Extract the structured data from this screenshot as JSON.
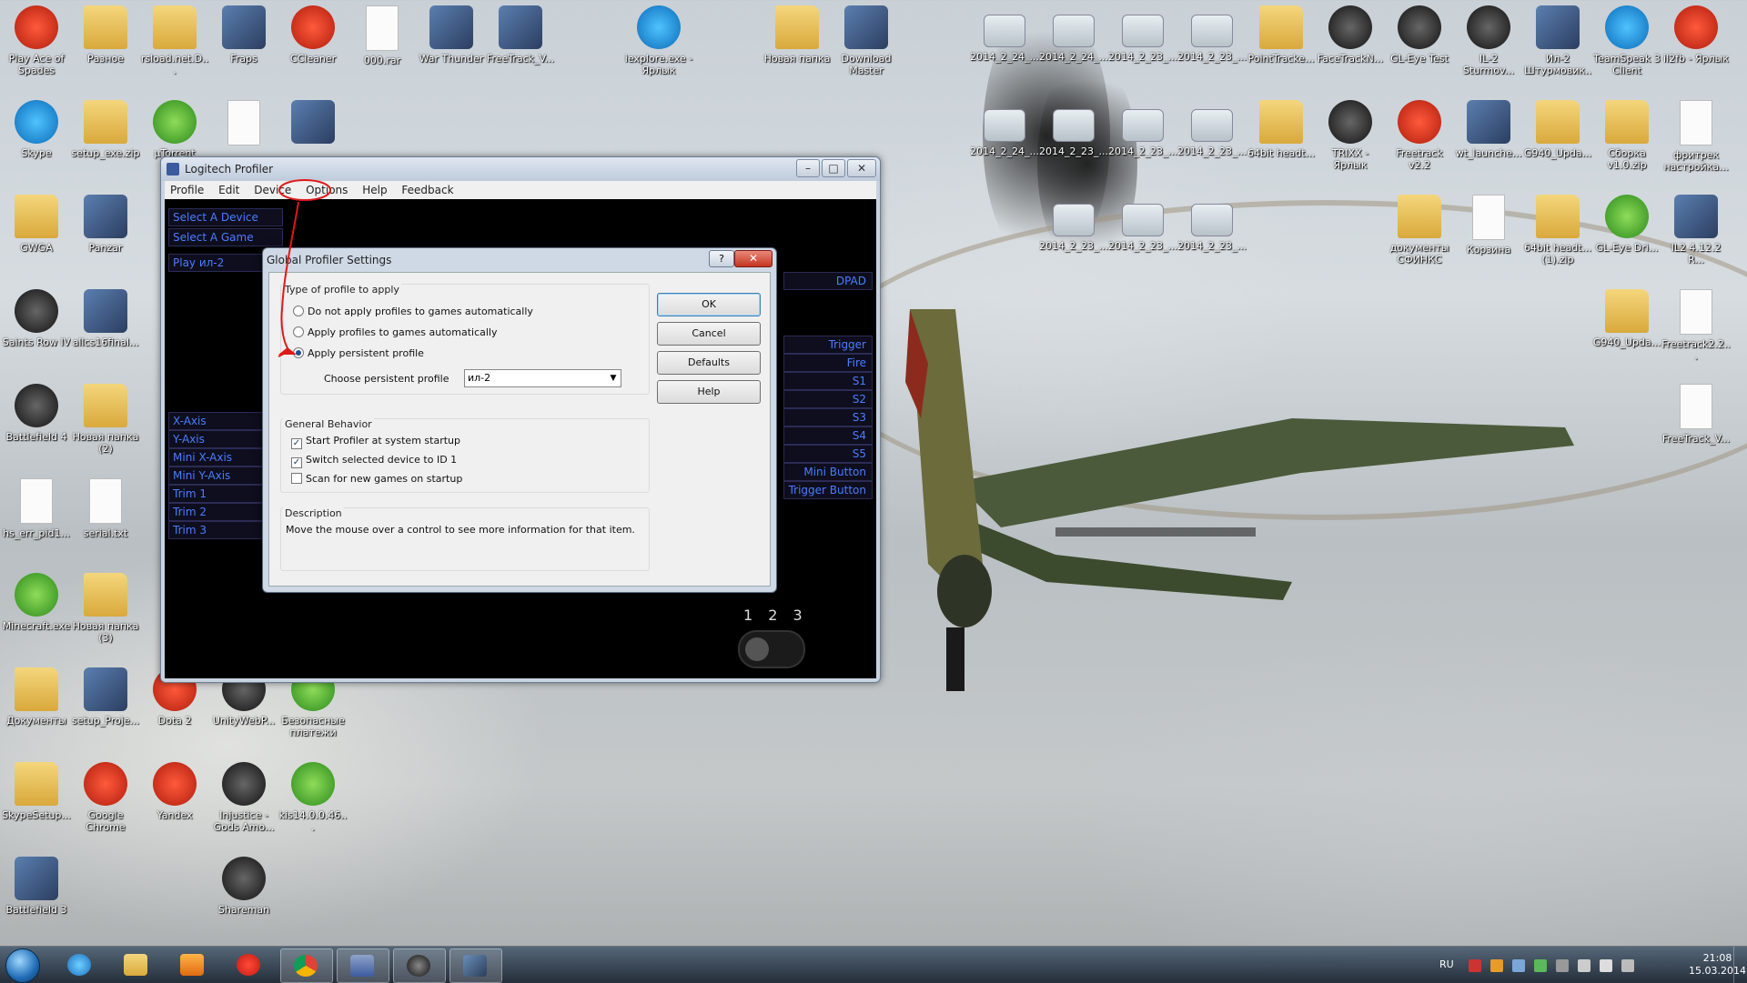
{
  "desktop_icons": [
    {
      "label": "Play Ace of Spades",
      "kind": "red"
    },
    {
      "label": "Разное",
      "kind": "folder"
    },
    {
      "label": "rsload.net.D...",
      "kind": "folder"
    },
    {
      "label": "Fraps",
      "kind": "app"
    },
    {
      "label": "CCleaner",
      "kind": "red"
    },
    {
      "label": "000.rar",
      "kind": "file"
    },
    {
      "label": "War Thunder",
      "kind": "app"
    },
    {
      "label": "FreeTrack_V...",
      "kind": "app"
    },
    {
      "label": "iexplore.exe - Ярлык",
      "kind": "blue"
    },
    {
      "label": "Новая папка",
      "kind": "folder"
    },
    {
      "label": "Download Master",
      "kind": "app"
    },
    {
      "label": "2014_2_24_...",
      "kind": "thumb"
    },
    {
      "label": "2014_2_24_...",
      "kind": "thumb"
    },
    {
      "label": "2014_2_23_...",
      "kind": "thumb"
    },
    {
      "label": "2014_2_23_...",
      "kind": "thumb"
    },
    {
      "label": "PointTracke...",
      "kind": "folder"
    },
    {
      "label": "FaceTrackN...",
      "kind": "dark"
    },
    {
      "label": "GL-Eye Test",
      "kind": "dark"
    },
    {
      "label": "IL-2 Sturmov...",
      "kind": "dark"
    },
    {
      "label": "Ил-2 Штурмовик...",
      "kind": "app"
    },
    {
      "label": "TeamSpeak 3 Client",
      "kind": "blue"
    },
    {
      "label": "il2fb - Ярлык",
      "kind": "red"
    },
    {
      "label": "Skype",
      "kind": "blue"
    },
    {
      "label": "setup_exe.zip",
      "kind": "folder"
    },
    {
      "label": "µTorrent",
      "kind": "green"
    },
    {
      "label": "",
      "kind": "file"
    },
    {
      "label": "",
      "kind": "app"
    },
    {
      "label": "2014_2_24_...",
      "kind": "thumb"
    },
    {
      "label": "2014_2_23_...",
      "kind": "thumb"
    },
    {
      "label": "2014_2_23_...",
      "kind": "thumb"
    },
    {
      "label": "2014_2_23_...",
      "kind": "thumb"
    },
    {
      "label": "64bit headt...",
      "kind": "folder"
    },
    {
      "label": "TRIXX - Ярлык",
      "kind": "dark"
    },
    {
      "label": "Freetrack v2.2",
      "kind": "red"
    },
    {
      "label": "wt_launche...",
      "kind": "app"
    },
    {
      "label": "G940_Upda...",
      "kind": "folder"
    },
    {
      "label": "Сборка v1.0.zip",
      "kind": "folder"
    },
    {
      "label": "фритрек настройка...",
      "kind": "file"
    },
    {
      "label": "GWGA",
      "kind": "folder"
    },
    {
      "label": "Panzar",
      "kind": "app"
    },
    {
      "label": "2014_2_23_...",
      "kind": "thumb"
    },
    {
      "label": "2014_2_23_...",
      "kind": "thumb"
    },
    {
      "label": "2014_2_23_...",
      "kind": "thumb"
    },
    {
      "label": "документы СФИНКС",
      "kind": "folder"
    },
    {
      "label": "Корзина",
      "kind": "file"
    },
    {
      "label": "64bit headt... (1).zip",
      "kind": "folder"
    },
    {
      "label": "GL-Eye Dri...",
      "kind": "green"
    },
    {
      "label": "IL2 4.12.2 R...",
      "kind": "app"
    },
    {
      "label": "Saints Row IV",
      "kind": "dark"
    },
    {
      "label": "allcs16final...",
      "kind": "app"
    },
    {
      "label": "G940_Upda...",
      "kind": "folder"
    },
    {
      "label": "Freetrack2.2...",
      "kind": "file"
    },
    {
      "label": "Battlefield 4",
      "kind": "dark"
    },
    {
      "label": "Новая папка (2)",
      "kind": "folder"
    },
    {
      "label": "FreeTrack_V...",
      "kind": "file"
    },
    {
      "label": "hs_err_pid1...",
      "kind": "file"
    },
    {
      "label": "serial.txt",
      "kind": "file"
    },
    {
      "label": "Minecraft.exe",
      "kind": "green"
    },
    {
      "label": "Новая папка (3)",
      "kind": "folder"
    },
    {
      "label": "Документы",
      "kind": "folder"
    },
    {
      "label": "setup_Proje...",
      "kind": "app"
    },
    {
      "label": "Dota 2",
      "kind": "red"
    },
    {
      "label": "UnityWebP...",
      "kind": "dark"
    },
    {
      "label": "Безопасные платежи",
      "kind": "green"
    },
    {
      "label": "SkypeSetup...",
      "kind": "folder"
    },
    {
      "label": "Google Chrome",
      "kind": "red"
    },
    {
      "label": "Yandex",
      "kind": "red"
    },
    {
      "label": "Injustice - Gods Amo...",
      "kind": "dark"
    },
    {
      "label": "kis14.0.0.46...",
      "kind": "green"
    },
    {
      "label": "Battlefield 3",
      "kind": "app"
    },
    {
      "label": "Shareman",
      "kind": "dark"
    }
  ],
  "profiler": {
    "title": "Logitech Profiler",
    "menu": [
      "Profile",
      "Edit",
      "Device",
      "Options",
      "Help",
      "Feedback"
    ],
    "sidebar_top": [
      "Select A Device",
      "Select A Game",
      "Play ил-2"
    ],
    "sidebar_axes": [
      "X-Axis",
      "Y-Axis",
      "Mini X-Axis",
      "Mini Y-Axis",
      "Trim 1",
      "Trim 2",
      "Trim 3"
    ],
    "right_controls": [
      "DPAD",
      "Trigger",
      "Fire",
      "S1",
      "S2",
      "S3",
      "S4",
      "S5",
      "Mini Button",
      "Trigger Button"
    ],
    "mode_numbers": "1 2 3",
    "window_buttons": {
      "minimize": "–",
      "maximize": "□",
      "close": "✕"
    }
  },
  "dialog": {
    "title": "Global Profiler Settings",
    "help_button": "?",
    "close_button": "✕",
    "group_type": "Type of profile to apply",
    "radio_options": [
      {
        "label": "Do not apply profiles to games automatically",
        "selected": false
      },
      {
        "label": "Apply profiles to games automatically",
        "selected": false
      },
      {
        "label": "Apply persistent profile",
        "selected": true
      }
    ],
    "persistent_label": "Choose persistent profile",
    "persistent_value": "ил-2",
    "group_general": "General Behavior",
    "checkboxes": [
      {
        "label": "Start Profiler at system startup",
        "checked": true
      },
      {
        "label": "Switch selected device to ID 1",
        "checked": true
      },
      {
        "label": "Scan for new games on startup",
        "checked": false
      }
    ],
    "group_description": "Description",
    "description_text": "Move the mouse over a control to see more information for that item.",
    "buttons": {
      "ok": "OK",
      "cancel": "Cancel",
      "defaults": "Defaults",
      "help": "Help"
    }
  },
  "taskbar": {
    "language": "RU",
    "time": "21:08",
    "date": "15.03.2014",
    "pinned": [
      "internet-explorer",
      "explorer",
      "media-player",
      "yandex",
      "chrome",
      "game-controller",
      "shareman",
      "il2"
    ]
  },
  "colors": {
    "annotation": "#e01818",
    "profiler_text": "#4a7dff"
  }
}
